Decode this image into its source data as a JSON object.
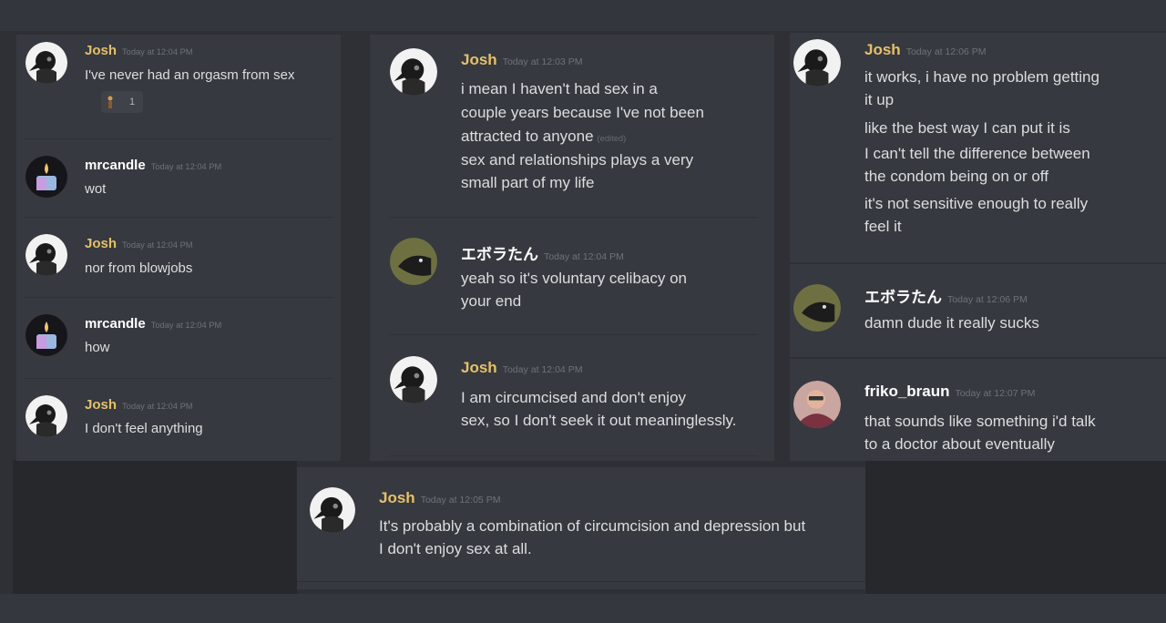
{
  "panel_left": {
    "messages": [
      {
        "author": "Josh",
        "timestamp": "Today at 12:04 PM",
        "lines": [
          "I've never had an orgasm from sex"
        ],
        "reaction": {
          "emoji": "person-emoji",
          "count": "1"
        }
      },
      {
        "author": "mrcandle",
        "timestamp": "Today at 12:04 PM",
        "lines": [
          "wot"
        ]
      },
      {
        "author": "Josh",
        "timestamp": "Today at 12:04 PM",
        "lines": [
          "nor from blowjobs"
        ]
      },
      {
        "author": "mrcandle",
        "timestamp": "Today at 12:04 PM",
        "lines": [
          "how"
        ]
      },
      {
        "author": "Josh",
        "timestamp": "Today at 12:04 PM",
        "lines": [
          "I don't feel anything"
        ]
      }
    ]
  },
  "panel_middle": {
    "messages": [
      {
        "author": "Josh",
        "timestamp": "Today at 12:03 PM",
        "lines": [
          "i mean I haven't had sex in a",
          "couple years because I've not been",
          "attracted to anyone"
        ],
        "edited": "(edited)",
        "lines2": [
          "sex and relationships plays a very",
          "small part of my life"
        ]
      },
      {
        "author": "エボラたん",
        "timestamp": "Today at 12:04 PM",
        "lines": [
          "yeah so it's voluntary celibacy on",
          "your end"
        ]
      },
      {
        "author": "Josh",
        "timestamp": "Today at 12:04 PM",
        "lines": [
          "I am circumcised and don't enjoy",
          "sex, so I don't seek it out meaninglessly."
        ]
      }
    ]
  },
  "panel_right": {
    "messages": [
      {
        "author": "Josh",
        "timestamp": "Today at 12:06 PM",
        "lines": [
          "it works, i have no problem getting",
          "it up"
        ],
        "lines2": [
          "like the best way I can put it is"
        ],
        "lines3": [
          "I can't tell the difference between",
          "the condom being on or off"
        ],
        "lines4": [
          "it's not sensitive enough to really",
          "feel it"
        ]
      },
      {
        "author": "エボラたん",
        "timestamp": "Today at 12:06 PM",
        "lines": [
          "damn dude it really sucks"
        ]
      },
      {
        "author": "friko_braun",
        "timestamp": "Today at 12:07 PM",
        "lines": [
          "that sounds like something i'd talk",
          "to a doctor about eventually"
        ]
      }
    ]
  },
  "panel_bottom": {
    "messages": [
      {
        "author": "Josh",
        "timestamp": "Today at 12:05 PM",
        "lines": [
          "It's probably a combination of circumcision and depression but",
          "I don't enjoy sex at all."
        ]
      }
    ]
  },
  "colors": {
    "background": "#2e3036",
    "panel": "#36393f",
    "josh_name": "#e6c068",
    "name_white": "#ffffff",
    "text": "#dcddde",
    "timestamp": "#6f7278"
  }
}
